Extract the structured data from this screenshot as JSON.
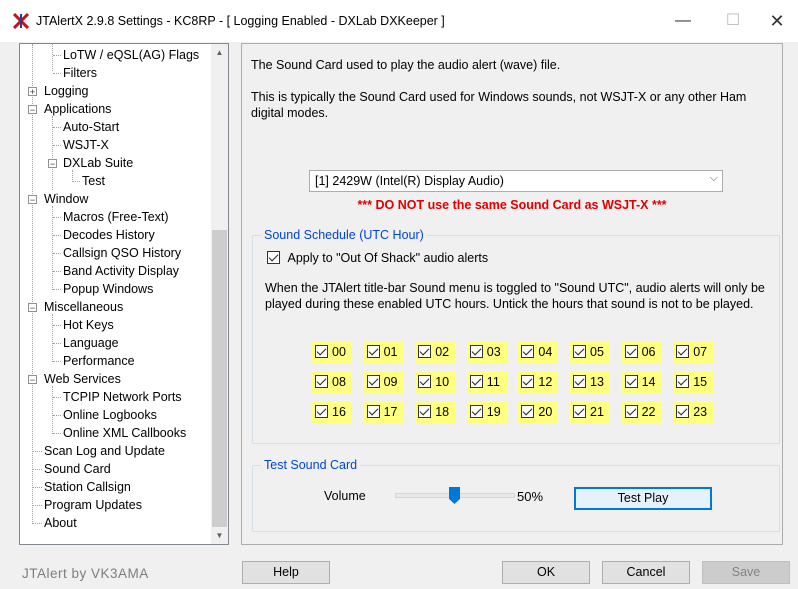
{
  "window": {
    "title": "JTAlertX 2.9.8 Settings   -   KC8RP   -  [ Logging Enabled - DXLab DXKeeper ]",
    "minimize_symbol": "—",
    "maximize_symbol": "☐",
    "close_symbol": "✕"
  },
  "tree": {
    "items": [
      {
        "label": "LoTW / eQSL(AG) Flags"
      },
      {
        "label": "Filters"
      },
      {
        "label": "Logging",
        "expander": "+"
      },
      {
        "label": "Applications",
        "expander": "−"
      },
      {
        "label": "Auto-Start"
      },
      {
        "label": "WSJT-X"
      },
      {
        "label": "DXLab Suite",
        "expander": "−"
      },
      {
        "label": "Test"
      },
      {
        "label": "Window",
        "expander": "−"
      },
      {
        "label": "Macros (Free-Text)"
      },
      {
        "label": "Decodes History"
      },
      {
        "label": "Callsign QSO History"
      },
      {
        "label": "Band Activity Display"
      },
      {
        "label": "Popup Windows"
      },
      {
        "label": "Miscellaneous",
        "expander": "−"
      },
      {
        "label": "Hot Keys"
      },
      {
        "label": "Language"
      },
      {
        "label": "Performance"
      },
      {
        "label": "Web Services",
        "expander": "−"
      },
      {
        "label": "TCPIP Network Ports"
      },
      {
        "label": "Online Logbooks"
      },
      {
        "label": "Online XML Callbooks"
      },
      {
        "label": "Scan Log and Update"
      },
      {
        "label": "Sound Card"
      },
      {
        "label": "Station Callsign"
      },
      {
        "label": "Program Updates"
      },
      {
        "label": "About"
      }
    ],
    "scroll_up": "▲",
    "scroll_down": "▼"
  },
  "credit": "JTAlert by VK3AMA",
  "sound_card": {
    "description_1": "The Sound Card used to play the audio alert (wave) file.",
    "description_2": "This is typically the Sound Card used for Windows sounds, not WSJT-X or any other Ham digital modes.",
    "device_selected": "[1] 2429W (Intel(R) Display Audio)",
    "warning": "*** DO NOT use the same Sound Card as WSJT-X ***"
  },
  "schedule": {
    "title": "Sound Schedule (UTC Hour)",
    "apply_label": "Apply to \"Out Of Shack\" audio alerts",
    "apply_checked": true,
    "description": "When the JTAlert title-bar Sound menu is toggled to \"Sound UTC\", audio alerts will only be played during these enabled UTC hours. Untick the hours that sound is not to be played.",
    "hours": [
      "00",
      "01",
      "02",
      "03",
      "04",
      "05",
      "06",
      "07",
      "08",
      "09",
      "10",
      "11",
      "12",
      "13",
      "14",
      "15",
      "16",
      "17",
      "18",
      "19",
      "20",
      "21",
      "22",
      "23"
    ],
    "highlight_color": "#ffff80"
  },
  "test_card": {
    "title": "Test Sound Card",
    "volume_label": "Volume",
    "volume_percent": 50,
    "volume_text": "50%",
    "test_button": "Test Play"
  },
  "footer": {
    "help": "Help",
    "ok": "OK",
    "cancel": "Cancel",
    "save": "Save"
  },
  "colors": {
    "accent": "#0078d7",
    "group_title": "#0046d5",
    "warning": "#e00000"
  }
}
